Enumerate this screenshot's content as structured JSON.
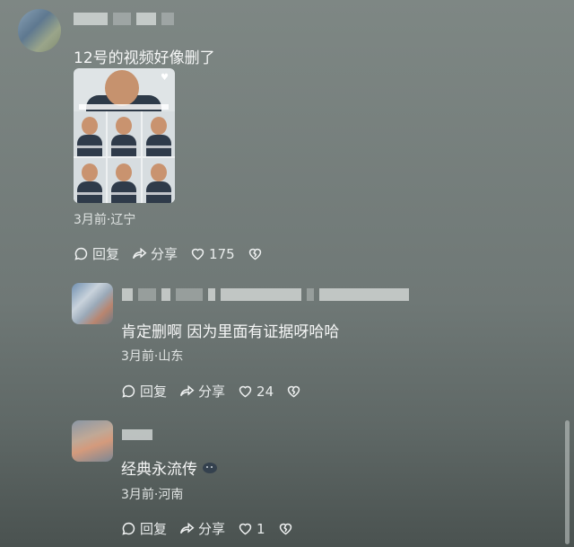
{
  "comments": [
    {
      "text": "12号的视频好像删了",
      "meta": "3月前·辽宁",
      "reply_label": "回复",
      "share_label": "分享",
      "like_count": "175"
    },
    {
      "text": "肯定删啊 因为里面有证据呀哈哈",
      "meta": "3月前·山东",
      "reply_label": "回复",
      "share_label": "分享",
      "like_count": "24"
    },
    {
      "text": "经典永流传",
      "meta": "3月前·河南",
      "reply_label": "回复",
      "share_label": "分享",
      "like_count": "1"
    }
  ],
  "icons": {
    "reply": "reply-bubble-icon",
    "share": "share-arrow-icon",
    "like": "heart-icon",
    "dislike": "broken-heart-icon",
    "emoji": "emoji-icon"
  },
  "colors": {
    "background_top": "#7e8784",
    "background_bottom": "#4a5250",
    "text": "#f5f6f6"
  }
}
